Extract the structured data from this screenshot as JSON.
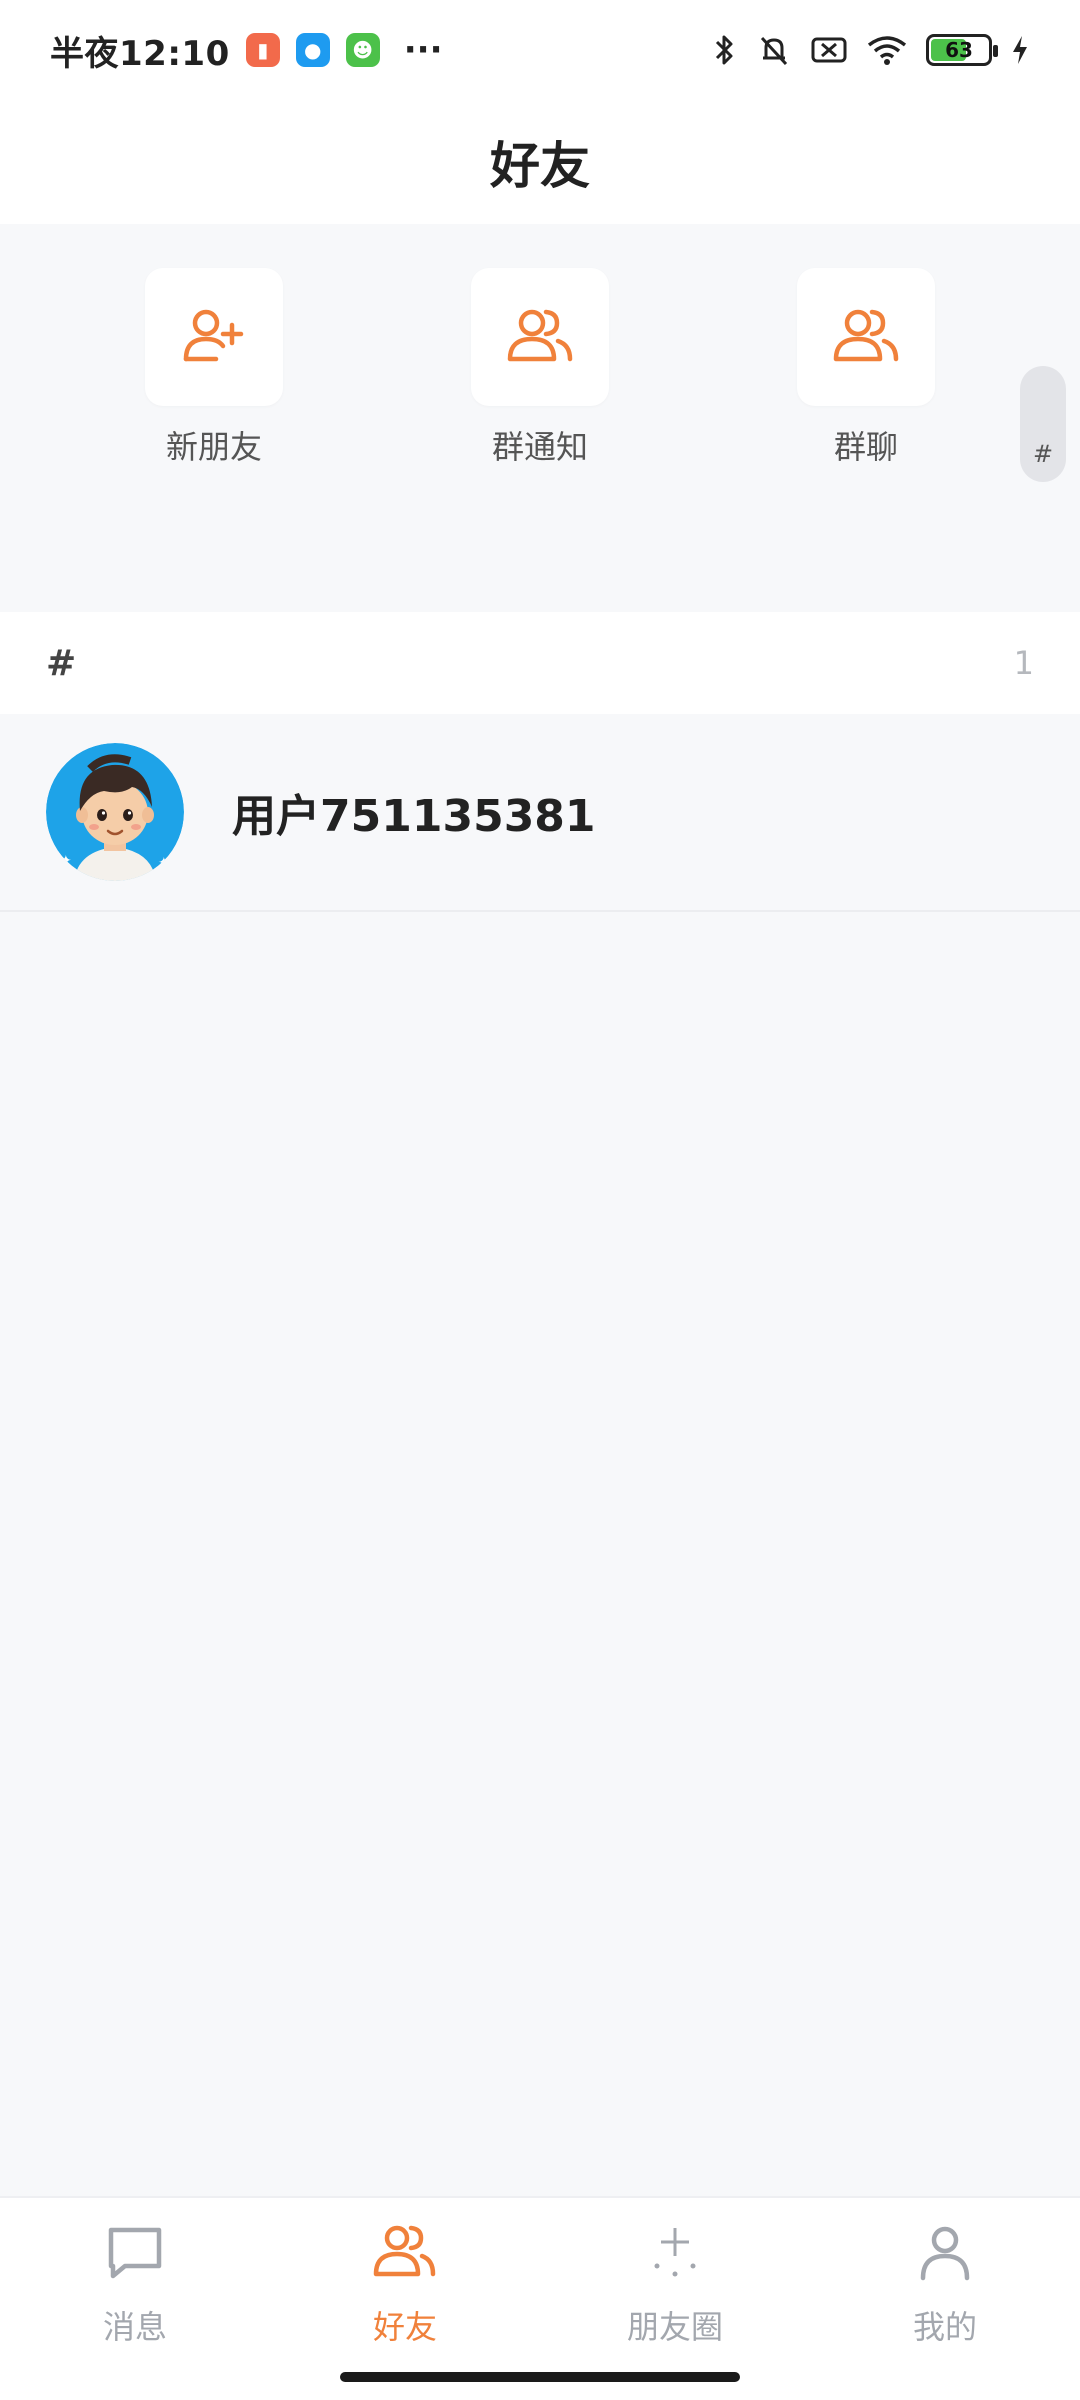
{
  "status_bar": {
    "time": "半夜12:10",
    "battery": "63",
    "battery_level": 0.63
  },
  "header": {
    "title": "好友"
  },
  "quick_actions": [
    {
      "label": "新朋友",
      "icon": "add-user-icon"
    },
    {
      "label": "群通知",
      "icon": "group-icon"
    },
    {
      "label": "群聊",
      "icon": "group-icon"
    }
  ],
  "index_bar": {
    "letter": "#"
  },
  "section": {
    "letter": "#",
    "count": "1"
  },
  "friends": [
    {
      "name": "用户751135381",
      "avatar": "cartoon-boy-avatar"
    }
  ],
  "bottom_nav": [
    {
      "label": "消息",
      "icon": "chat-bubble-icon",
      "active": false
    },
    {
      "label": "好友",
      "icon": "friends-icon",
      "active": true
    },
    {
      "label": "朋友圈",
      "icon": "sparkle-icon",
      "active": false
    },
    {
      "label": "我的",
      "icon": "person-icon",
      "active": false
    }
  ],
  "colors": {
    "accent": "#F0813B",
    "inactive": "#A3A7AE",
    "background": "#F7F8FA"
  }
}
